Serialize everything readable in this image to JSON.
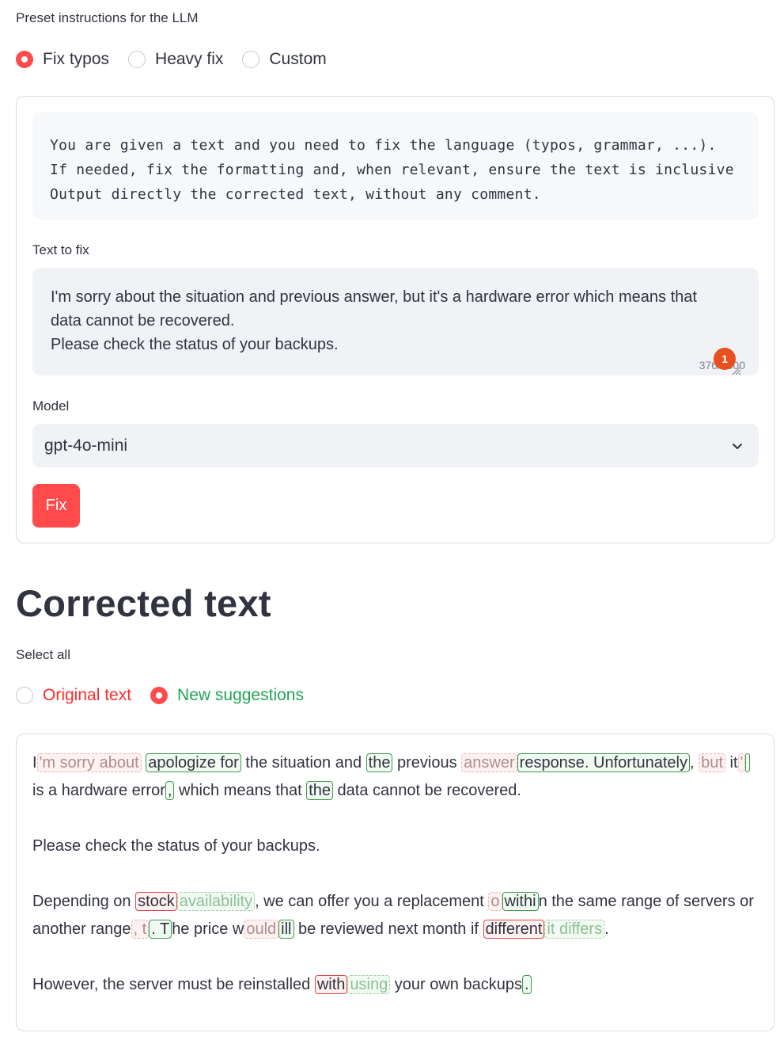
{
  "preset": {
    "label": "Preset instructions for the LLM",
    "options": [
      "Fix typos",
      "Heavy fix",
      "Custom"
    ],
    "selected": "Fix typos"
  },
  "prompt_lines": [
    "You are given a text and you need to fix the language (typos, grammar, ...).",
    "If needed, fix the formatting and, when relevant, ensure the text is inclusive",
    "Output directly the corrected text, without any comment."
  ],
  "text_to_fix": {
    "label": "Text to fix",
    "lines": [
      "I'm sorry about the situation and previous answer, but it's a hardware error which means that",
      "data cannot be recovered.",
      "",
      "Please check the status of your backups."
    ],
    "counter": "376/3000",
    "badge": "1"
  },
  "model": {
    "label": "Model",
    "value": "gpt-4o-mini"
  },
  "fix_button": "Fix",
  "result": {
    "heading": "Corrected text",
    "select_all_label": "Select all",
    "options": [
      "Original text",
      "New suggestions"
    ],
    "selected": "New suggestions",
    "paragraphs": [
      [
        {
          "t": "I"
        },
        {
          "t": "'m sorry about",
          "k": "del"
        },
        {
          "t": " "
        },
        {
          "t": "apologize for",
          "k": "ins"
        },
        {
          "t": " the situation and "
        },
        {
          "t": "the",
          "k": "ins"
        },
        {
          "t": " previous "
        },
        {
          "t": "answer",
          "k": "del"
        },
        {
          "t": "response. Unfortunately",
          "k": "ins"
        },
        {
          "t": ", "
        },
        {
          "t": "but",
          "k": "del"
        },
        {
          "t": " it"
        },
        {
          "t": "'",
          "k": "del"
        },
        {
          "t": " ",
          "k": "ins"
        },
        {
          "t": "i"
        },
        {
          "t": "s a hardware erro"
        },
        {
          "t": "r"
        },
        {
          "t": ",",
          "k": "ins"
        },
        {
          "t": " which means that "
        },
        {
          "t": "the",
          "k": "ins"
        },
        {
          "t": " data cannot be recovered."
        }
      ],
      [
        {
          "t": "Please check the status of your backups."
        }
      ],
      [
        {
          "t": "Depending on "
        },
        {
          "t": "stock",
          "k": "sel-del"
        },
        {
          "t": "availability",
          "k": "sel-ins"
        },
        {
          "t": ", we can offer you a replacement "
        },
        {
          "t": "o",
          "k": "del"
        },
        {
          "t": "withi",
          "k": "ins"
        },
        {
          "t": "n the same range of servers or another range"
        },
        {
          "t": ", t",
          "k": "del"
        },
        {
          "t": ". T",
          "k": "ins"
        },
        {
          "t": "he price w"
        },
        {
          "t": "ould",
          "k": "del"
        },
        {
          "t": "ill",
          "k": "ins"
        },
        {
          "t": " be reviewed next month if "
        },
        {
          "t": "different",
          "k": "sel-del"
        },
        {
          "t": "it differs",
          "k": "sel-ins"
        },
        {
          "t": "."
        }
      ],
      [
        {
          "t": "However, the server must be reinstalled "
        },
        {
          "t": "with",
          "k": "sel-del"
        },
        {
          "t": "using",
          "k": "sel-ins"
        },
        {
          "t": " your own backups"
        },
        {
          "t": ".",
          "k": "ins"
        }
      ]
    ]
  }
}
